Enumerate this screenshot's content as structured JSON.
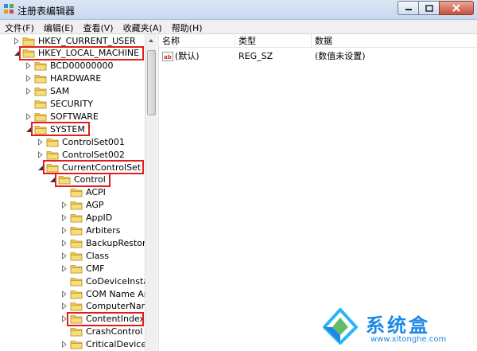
{
  "window": {
    "title": "注册表编辑器"
  },
  "menu": [
    {
      "label": "文件(F)"
    },
    {
      "label": "编辑(E)"
    },
    {
      "label": "查看(V)"
    },
    {
      "label": "收藏夹(A)"
    },
    {
      "label": "帮助(H)"
    }
  ],
  "tree": [
    {
      "label": "HKEY_CURRENT_USER",
      "depth": 0,
      "expander": "collapsed",
      "highlight": false
    },
    {
      "label": "HKEY_LOCAL_MACHINE",
      "depth": 0,
      "expander": "expanded",
      "highlight": true
    },
    {
      "label": "BCD00000000",
      "depth": 1,
      "expander": "collapsed",
      "highlight": false
    },
    {
      "label": "HARDWARE",
      "depth": 1,
      "expander": "collapsed",
      "highlight": false
    },
    {
      "label": "SAM",
      "depth": 1,
      "expander": "collapsed",
      "highlight": false
    },
    {
      "label": "SECURITY",
      "depth": 1,
      "expander": "none",
      "highlight": false
    },
    {
      "label": "SOFTWARE",
      "depth": 1,
      "expander": "collapsed",
      "highlight": false
    },
    {
      "label": "SYSTEM",
      "depth": 1,
      "expander": "expanded",
      "highlight": true
    },
    {
      "label": "ControlSet001",
      "depth": 2,
      "expander": "collapsed",
      "highlight": false
    },
    {
      "label": "ControlSet002",
      "depth": 2,
      "expander": "collapsed",
      "highlight": false
    },
    {
      "label": "CurrentControlSet",
      "depth": 2,
      "expander": "expanded",
      "highlight": true
    },
    {
      "label": "Control",
      "depth": 3,
      "expander": "expanded",
      "highlight": true
    },
    {
      "label": "ACPI",
      "depth": 4,
      "expander": "none",
      "highlight": false
    },
    {
      "label": "AGP",
      "depth": 4,
      "expander": "collapsed",
      "highlight": false
    },
    {
      "label": "AppID",
      "depth": 4,
      "expander": "collapsed",
      "highlight": false
    },
    {
      "label": "Arbiters",
      "depth": 4,
      "expander": "collapsed",
      "highlight": false
    },
    {
      "label": "BackupRestore",
      "depth": 4,
      "expander": "collapsed",
      "highlight": false
    },
    {
      "label": "Class",
      "depth": 4,
      "expander": "collapsed",
      "highlight": false
    },
    {
      "label": "CMF",
      "depth": 4,
      "expander": "collapsed",
      "highlight": false
    },
    {
      "label": "CoDeviceInstallers",
      "depth": 4,
      "expander": "none",
      "highlight": false
    },
    {
      "label": "COM Name Arbiter",
      "depth": 4,
      "expander": "collapsed",
      "highlight": false
    },
    {
      "label": "ComputerName",
      "depth": 4,
      "expander": "collapsed",
      "highlight": false
    },
    {
      "label": "ContentIndex",
      "depth": 4,
      "expander": "collapsed",
      "highlight": true
    },
    {
      "label": "CrashControl",
      "depth": 4,
      "expander": "none",
      "highlight": false
    },
    {
      "label": "CriticalDeviceDatabase",
      "depth": 4,
      "expander": "collapsed",
      "highlight": false
    }
  ],
  "list": {
    "headers": {
      "name": "名称",
      "type": "类型",
      "data": "数据"
    },
    "rows": [
      {
        "name": "(默认)",
        "type": "REG_SZ",
        "data": "(数值未设置)"
      }
    ]
  },
  "watermark": {
    "name": "系统盒",
    "url": "www.xitonghe.com"
  },
  "colors": {
    "highlight": "#e31d1d",
    "folder": "#f2c94c",
    "watermark": "#1e88e5"
  }
}
